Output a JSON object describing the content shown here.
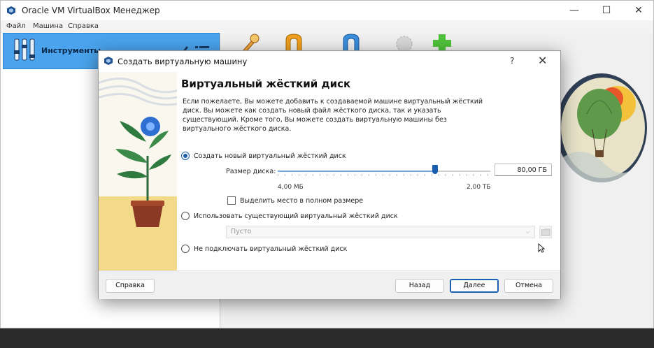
{
  "window": {
    "title": "Oracle VM VirtualBox Менеджер",
    "minimize": "—",
    "maximize": "☐",
    "close": "✕"
  },
  "menubar": {
    "items": [
      "Файл",
      "Машина",
      "Справка"
    ]
  },
  "sidebar": {
    "tools_label": "Инструменты"
  },
  "dialog": {
    "title": "Создать виртуальную машину",
    "help_glyph": "?",
    "close_glyph": "✕",
    "page_title": "Виртуальный жёсткий диск",
    "description": "Если пожелаете, Вы можете добавить к создаваемой машине виртуальный жёсткий диск. Вы можете как создать новый файл жёсткого диска, так и указать существующий. Кроме того, Вы можете создать виртуальную машины без виртуального жёсткого диска.",
    "options": {
      "create_new": "Создать новый виртуальный жёсткий диск",
      "use_existing": "Использовать существующий виртуальный жёсткий диск",
      "no_disk": "Не подключать виртуальный жёсткий диск"
    },
    "selected_option": "create_new",
    "disk_size": {
      "label": "Размер диска:",
      "value": "80,00 ГБ",
      "min_label": "4,00 МБ",
      "max_label": "2,00 ТБ",
      "slider_fraction": 0.74
    },
    "preallocate": {
      "label": "Выделить место в полном размере",
      "checked": false
    },
    "existing_disk": {
      "value": "Пусто",
      "arrow": "⌵"
    },
    "buttons": {
      "help": "Справка",
      "back": "Назад",
      "next": "Далее",
      "cancel": "Отмена"
    }
  },
  "colors": {
    "accent": "#1b5fb0",
    "tools_highlight": "#4aa3ec",
    "illustration_sand": "#f3d98a"
  }
}
